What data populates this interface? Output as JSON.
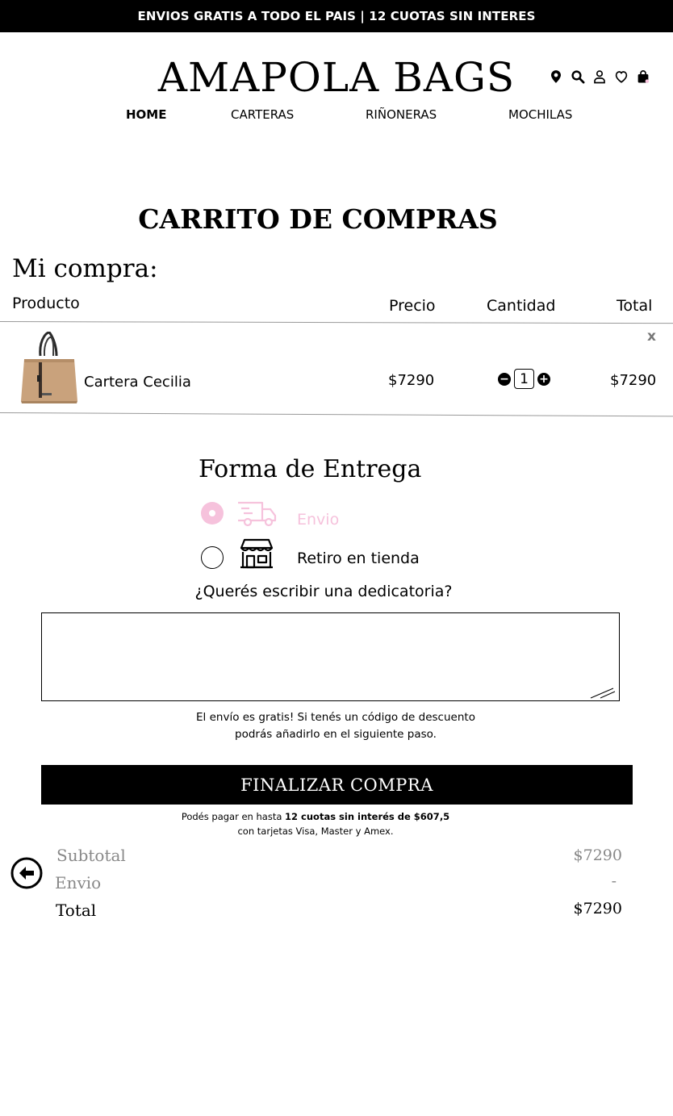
{
  "topbar": {
    "text": "ENVIOS GRATIS A TODO EL PAIS | 12 CUOTAS SIN INTERES"
  },
  "brand": {
    "name": "AMAPOLA BAGS"
  },
  "header_icons": [
    "location-pin-icon",
    "search-icon",
    "user-icon",
    "heart-icon",
    "shopping-bag-icon"
  ],
  "nav": {
    "items": [
      {
        "label": "HOME",
        "active": true
      },
      {
        "label": "CARTERAS"
      },
      {
        "label": "RIÑONERAS"
      },
      {
        "label": "MOCHILAS"
      }
    ]
  },
  "cart": {
    "title": "CARRITO DE COMPRAS",
    "subtitle": "Mi compra:",
    "columns": {
      "product": "Producto",
      "price": "Precio",
      "quantity": "Cantidad",
      "total": "Total"
    },
    "remove_label": "x",
    "items": [
      {
        "name": "Cartera Cecilia",
        "price": "$7290",
        "quantity": "1",
        "total": "$7290"
      }
    ]
  },
  "delivery": {
    "title": "Forma de Entrega",
    "options": [
      {
        "label": "Envio",
        "icon": "truck-icon",
        "selected": true
      },
      {
        "label": "Retiro en tienda",
        "icon": "store-icon",
        "selected": false
      }
    ]
  },
  "dedication": {
    "question": "¿Querés escribir una dedicatoria?",
    "value": ""
  },
  "shipping_note": {
    "line1": "El envío es gratis! Si tenés un código de descuento",
    "line2": "podrás añadirlo en el siguiente paso."
  },
  "checkout": {
    "button_label": "FINALIZAR COMPRA"
  },
  "payment_note": {
    "prefix": "Podés pagar en hasta ",
    "bold": "12 cuotas sin interés de $607,5",
    "line2": "con tarjetas Visa, Master y Amex."
  },
  "summary": {
    "subtotal_label": "Subtotal",
    "subtotal_value": "$7290",
    "shipping_label": "Envio",
    "shipping_value": "-",
    "total_label": "Total",
    "total_value": "$7290"
  },
  "colors": {
    "accent_pink": "#f6c2dc",
    "bag_tan": "#c9a27c",
    "black": "#000000"
  }
}
